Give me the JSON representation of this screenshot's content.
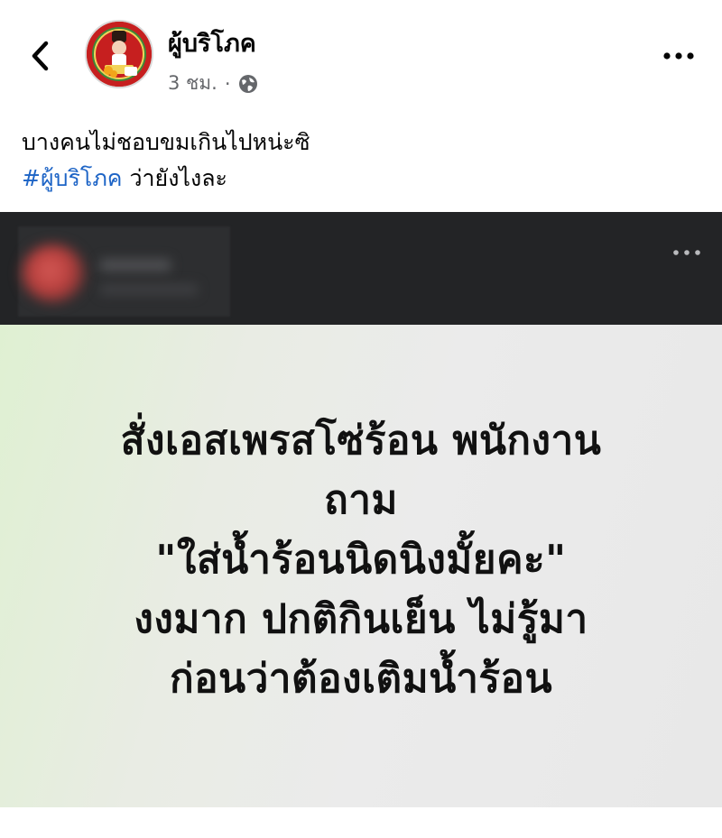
{
  "post": {
    "author_name": "ผู้บริโภค",
    "time_text": "3 ชม.",
    "separator": "·",
    "caption_line1": "บางคนไม่ชอบขมเกินไปหน่ะซิ",
    "caption_hashtag": "#ผู้บริโภค",
    "caption_line2_rest": " ว่ายังไงละ"
  },
  "quote_image": {
    "lines": [
      "สั่งเอสเพรสโซ่ร้อน พนักงาน",
      "ถาม",
      "\"ใส่น้ำร้อนนิดนิงมั้ยคะ\"",
      "งงมาก ปกติกินเย็น ไม่รู้มา",
      "ก่อนว่าต้องเติมน้ำร้อน"
    ]
  },
  "icons": {
    "back": "chevron-left-icon",
    "more": "more-horizontal-icon",
    "audience": "globe-icon"
  },
  "colors": {
    "hashtag": "#1d64c6",
    "meta_text": "#65676b",
    "dark_bar": "#232426",
    "avatar_red": "#c61f1f"
  }
}
